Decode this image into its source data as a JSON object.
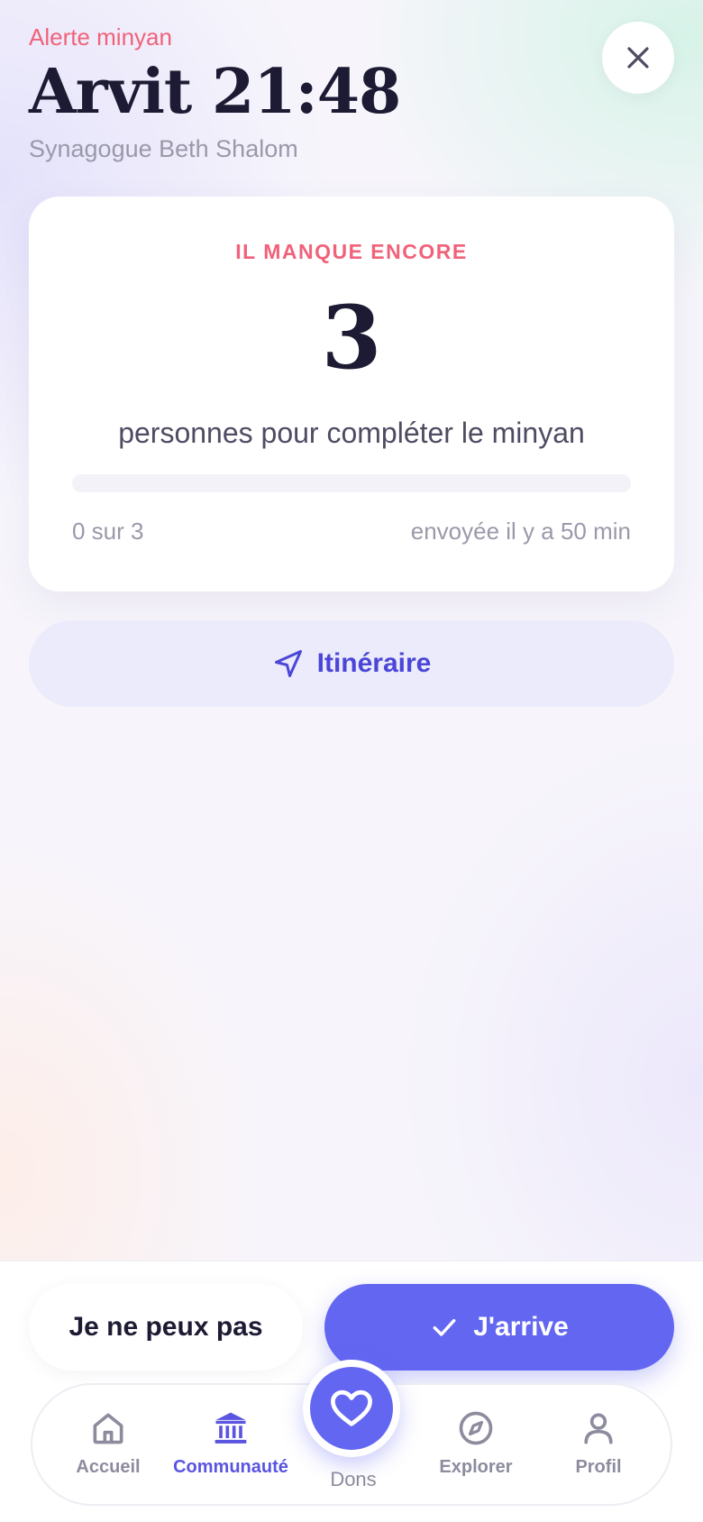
{
  "header": {
    "eyebrow": "Alerte minyan",
    "title": "Arvit 21:48",
    "subtitle": "Synagogue Beth Shalom",
    "close_icon": "close-icon"
  },
  "card": {
    "eyebrow": "IL MANQUE ENCORE",
    "count": "3",
    "description": "personnes pour compléter le minyan",
    "progress_fraction": 0,
    "progress_text": "0 sur 3",
    "sent_text": "envoyée il y a 50 min"
  },
  "itinerary": {
    "label": "Itinéraire",
    "icon": "navigation-arrow-icon"
  },
  "actions": {
    "cant_label": "Je ne peux pas",
    "arrive_label": "J'arrive",
    "arrive_icon": "check-icon"
  },
  "tabs": [
    {
      "label": "Accueil",
      "icon": "home-icon",
      "active": false
    },
    {
      "label": "Communauté",
      "icon": "synagogue-icon",
      "active": true
    },
    {
      "label": "Dons",
      "icon": "heart-icon",
      "active": false
    },
    {
      "label": "Explorer",
      "icon": "compass-icon",
      "active": false
    },
    {
      "label": "Profil",
      "icon": "user-icon",
      "active": false
    }
  ],
  "colors": {
    "accent": "#6366f1",
    "alert": "#f0627a",
    "text_dark": "#1d1b33",
    "text_muted": "#9a99aa"
  }
}
